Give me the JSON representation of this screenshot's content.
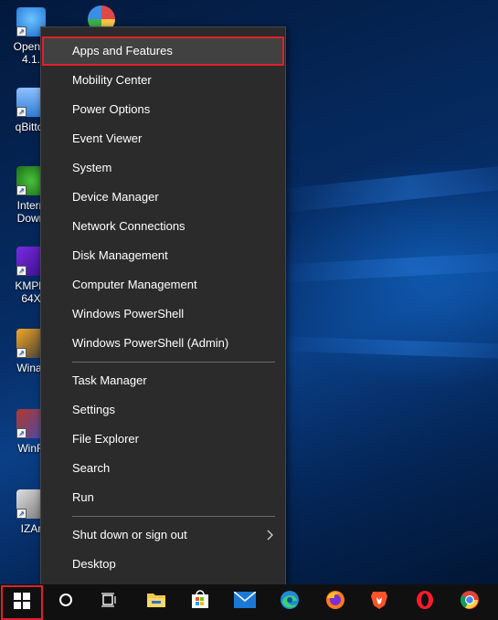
{
  "desktop": {
    "icons": [
      {
        "label_line1": "OpenO",
        "label_line2": "4.1.",
        "icon": "openoffice-icon"
      },
      {
        "label_line1": "qBittor",
        "label_line2": "",
        "icon": "qbittorrent-icon"
      },
      {
        "label_line1": "Intern",
        "label_line2": "Down",
        "icon": "internet-download-manager-icon"
      },
      {
        "label_line1": "KMPla",
        "label_line2": "64X",
        "icon": "kmplayer-icon"
      },
      {
        "label_line1": "Winar",
        "label_line2": "",
        "icon": "winamp-icon"
      },
      {
        "label_line1": "WinR",
        "label_line2": "",
        "icon": "winrar-icon"
      },
      {
        "label_line1": "IZAr",
        "label_line2": "",
        "icon": "izarc-icon"
      }
    ]
  },
  "menu": {
    "group1": [
      "Apps and Features",
      "Mobility Center",
      "Power Options",
      "Event Viewer",
      "System",
      "Device Manager",
      "Network Connections",
      "Disk Management",
      "Computer Management",
      "Windows PowerShell",
      "Windows PowerShell (Admin)"
    ],
    "group2": [
      "Task Manager",
      "Settings",
      "File Explorer",
      "Search",
      "Run"
    ],
    "group3": [
      "Shut down or sign out",
      "Desktop"
    ],
    "highlighted_item": "Apps and Features",
    "highlight_color": "#e0202d"
  },
  "taskbar": {
    "items": [
      "start-windows-icon",
      "search-circle-icon",
      "task-view-icon",
      "file-explorer-icon",
      "microsoft-store-icon",
      "mail-icon",
      "edge-icon",
      "firefox-icon",
      "brave-icon",
      "opera-icon",
      "chrome-icon"
    ]
  }
}
